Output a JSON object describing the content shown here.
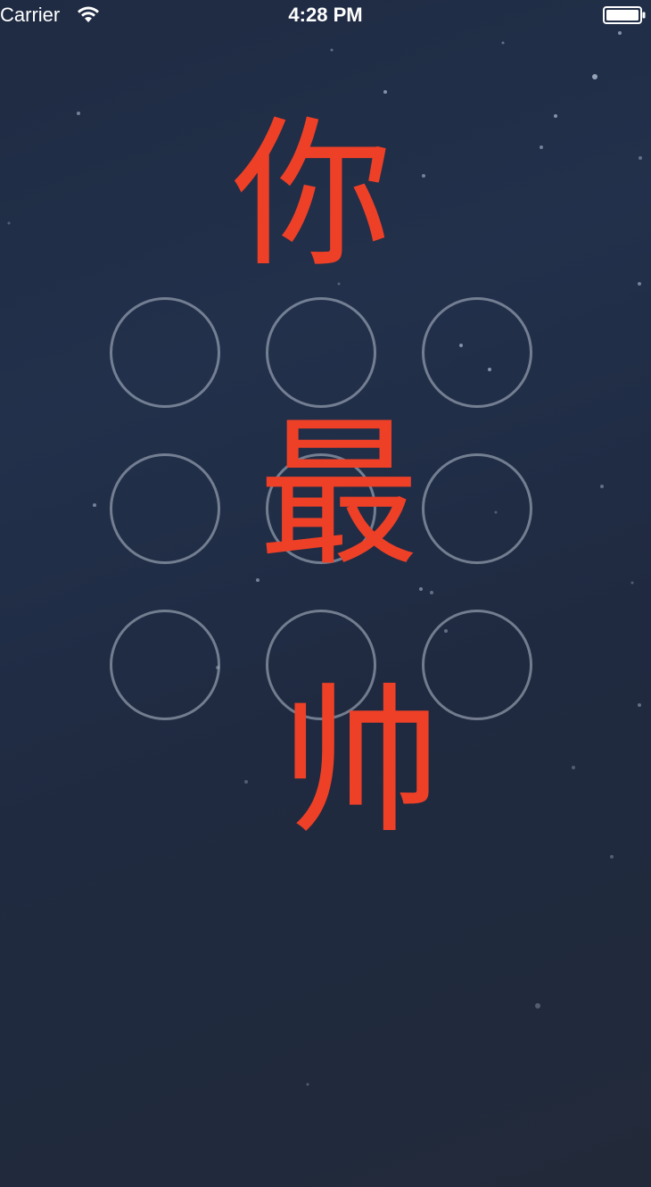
{
  "status_bar": {
    "carrier": "Carrier",
    "time": "4:28 PM",
    "wifi_icon": "wifi-icon",
    "battery_icon": "battery-icon"
  },
  "lock_pattern": {
    "node_count": 9,
    "rows": 3,
    "columns": 3,
    "ring_color": "#aab4c3"
  },
  "overlay_text": {
    "char_1": "你",
    "char_2": "最",
    "char_3": "帅",
    "color": "#ee4027"
  },
  "background": {
    "color": "#1f2b42"
  }
}
